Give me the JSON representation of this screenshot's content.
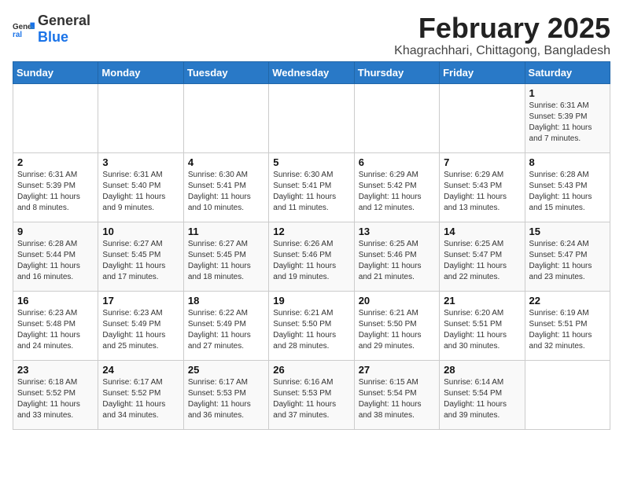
{
  "header": {
    "logo_general": "General",
    "logo_blue": "Blue",
    "title": "February 2025",
    "subtitle": "Khagrachhari, Chittagong, Bangladesh"
  },
  "weekdays": [
    "Sunday",
    "Monday",
    "Tuesday",
    "Wednesday",
    "Thursday",
    "Friday",
    "Saturday"
  ],
  "weeks": [
    [
      {
        "day": "",
        "info": ""
      },
      {
        "day": "",
        "info": ""
      },
      {
        "day": "",
        "info": ""
      },
      {
        "day": "",
        "info": ""
      },
      {
        "day": "",
        "info": ""
      },
      {
        "day": "",
        "info": ""
      },
      {
        "day": "1",
        "info": "Sunrise: 6:31 AM\nSunset: 5:39 PM\nDaylight: 11 hours\nand 7 minutes."
      }
    ],
    [
      {
        "day": "2",
        "info": "Sunrise: 6:31 AM\nSunset: 5:39 PM\nDaylight: 11 hours\nand 8 minutes."
      },
      {
        "day": "3",
        "info": "Sunrise: 6:31 AM\nSunset: 5:40 PM\nDaylight: 11 hours\nand 9 minutes."
      },
      {
        "day": "4",
        "info": "Sunrise: 6:30 AM\nSunset: 5:41 PM\nDaylight: 11 hours\nand 10 minutes."
      },
      {
        "day": "5",
        "info": "Sunrise: 6:30 AM\nSunset: 5:41 PM\nDaylight: 11 hours\nand 11 minutes."
      },
      {
        "day": "6",
        "info": "Sunrise: 6:29 AM\nSunset: 5:42 PM\nDaylight: 11 hours\nand 12 minutes."
      },
      {
        "day": "7",
        "info": "Sunrise: 6:29 AM\nSunset: 5:43 PM\nDaylight: 11 hours\nand 13 minutes."
      },
      {
        "day": "8",
        "info": "Sunrise: 6:28 AM\nSunset: 5:43 PM\nDaylight: 11 hours\nand 15 minutes."
      }
    ],
    [
      {
        "day": "9",
        "info": "Sunrise: 6:28 AM\nSunset: 5:44 PM\nDaylight: 11 hours\nand 16 minutes."
      },
      {
        "day": "10",
        "info": "Sunrise: 6:27 AM\nSunset: 5:45 PM\nDaylight: 11 hours\nand 17 minutes."
      },
      {
        "day": "11",
        "info": "Sunrise: 6:27 AM\nSunset: 5:45 PM\nDaylight: 11 hours\nand 18 minutes."
      },
      {
        "day": "12",
        "info": "Sunrise: 6:26 AM\nSunset: 5:46 PM\nDaylight: 11 hours\nand 19 minutes."
      },
      {
        "day": "13",
        "info": "Sunrise: 6:25 AM\nSunset: 5:46 PM\nDaylight: 11 hours\nand 21 minutes."
      },
      {
        "day": "14",
        "info": "Sunrise: 6:25 AM\nSunset: 5:47 PM\nDaylight: 11 hours\nand 22 minutes."
      },
      {
        "day": "15",
        "info": "Sunrise: 6:24 AM\nSunset: 5:47 PM\nDaylight: 11 hours\nand 23 minutes."
      }
    ],
    [
      {
        "day": "16",
        "info": "Sunrise: 6:23 AM\nSunset: 5:48 PM\nDaylight: 11 hours\nand 24 minutes."
      },
      {
        "day": "17",
        "info": "Sunrise: 6:23 AM\nSunset: 5:49 PM\nDaylight: 11 hours\nand 25 minutes."
      },
      {
        "day": "18",
        "info": "Sunrise: 6:22 AM\nSunset: 5:49 PM\nDaylight: 11 hours\nand 27 minutes."
      },
      {
        "day": "19",
        "info": "Sunrise: 6:21 AM\nSunset: 5:50 PM\nDaylight: 11 hours\nand 28 minutes."
      },
      {
        "day": "20",
        "info": "Sunrise: 6:21 AM\nSunset: 5:50 PM\nDaylight: 11 hours\nand 29 minutes."
      },
      {
        "day": "21",
        "info": "Sunrise: 6:20 AM\nSunset: 5:51 PM\nDaylight: 11 hours\nand 30 minutes."
      },
      {
        "day": "22",
        "info": "Sunrise: 6:19 AM\nSunset: 5:51 PM\nDaylight: 11 hours\nand 32 minutes."
      }
    ],
    [
      {
        "day": "23",
        "info": "Sunrise: 6:18 AM\nSunset: 5:52 PM\nDaylight: 11 hours\nand 33 minutes."
      },
      {
        "day": "24",
        "info": "Sunrise: 6:17 AM\nSunset: 5:52 PM\nDaylight: 11 hours\nand 34 minutes."
      },
      {
        "day": "25",
        "info": "Sunrise: 6:17 AM\nSunset: 5:53 PM\nDaylight: 11 hours\nand 36 minutes."
      },
      {
        "day": "26",
        "info": "Sunrise: 6:16 AM\nSunset: 5:53 PM\nDaylight: 11 hours\nand 37 minutes."
      },
      {
        "day": "27",
        "info": "Sunrise: 6:15 AM\nSunset: 5:54 PM\nDaylight: 11 hours\nand 38 minutes."
      },
      {
        "day": "28",
        "info": "Sunrise: 6:14 AM\nSunset: 5:54 PM\nDaylight: 11 hours\nand 39 minutes."
      },
      {
        "day": "",
        "info": ""
      }
    ]
  ]
}
